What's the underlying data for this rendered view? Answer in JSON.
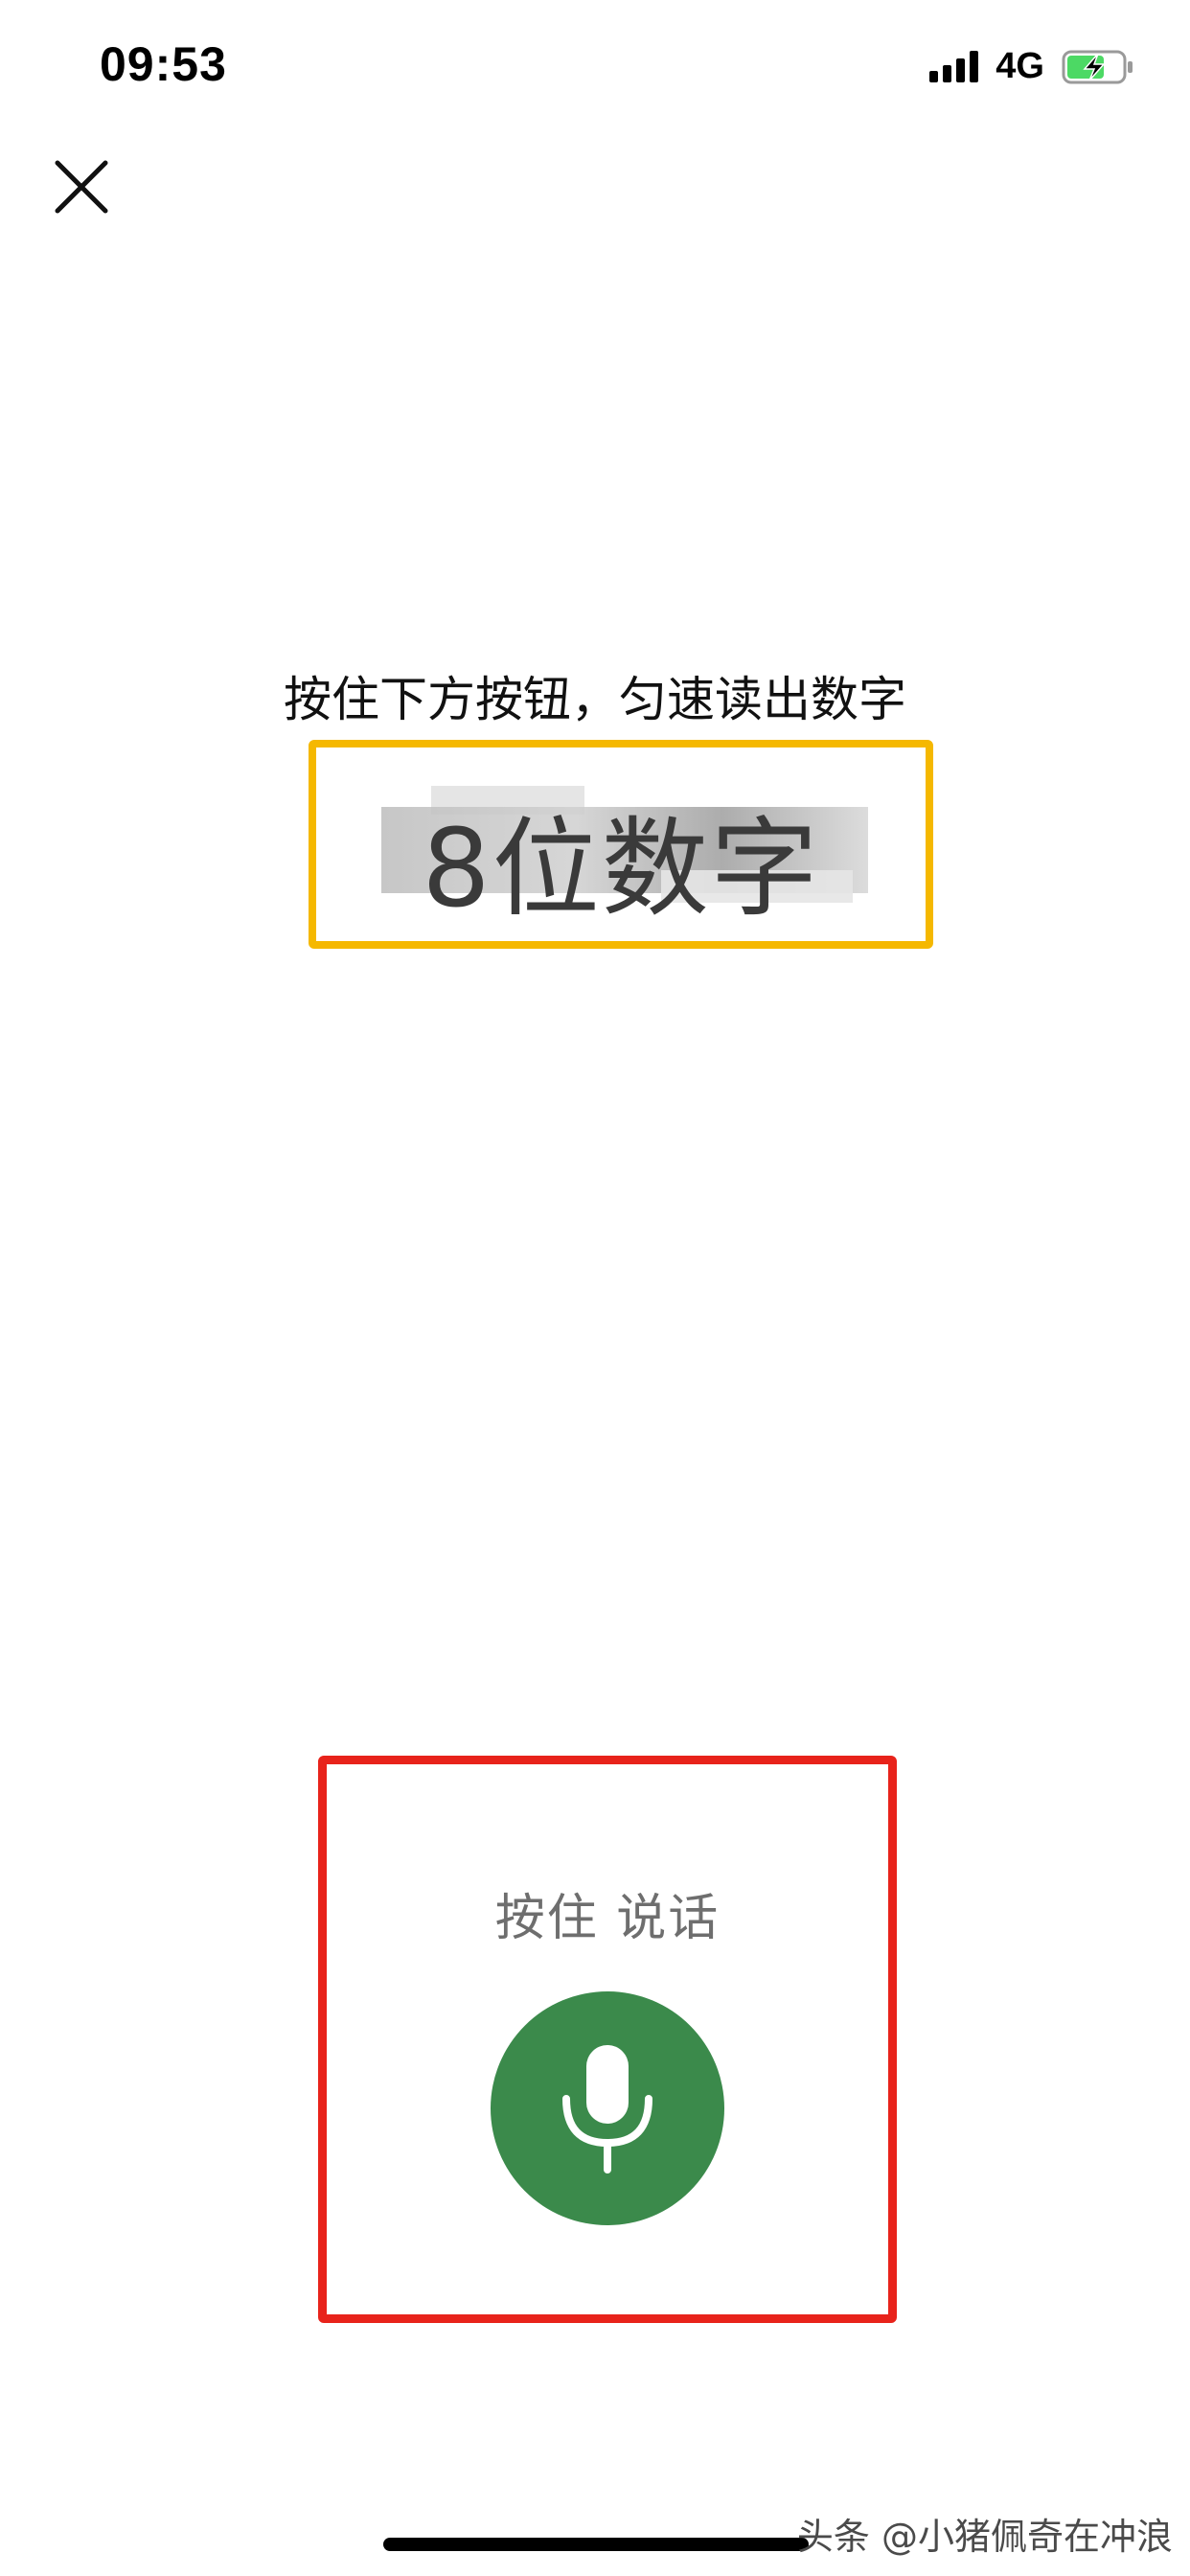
{
  "status_bar": {
    "time": "09:53",
    "network": "4G",
    "icons": [
      "signal-icon",
      "battery-charging-icon"
    ]
  },
  "header": {
    "close_icon": "close-icon"
  },
  "main": {
    "instruction": "按住下方按钮，匀速读出数字",
    "digits_placeholder": "8位数字"
  },
  "speak": {
    "label": "按住 说话",
    "mic_icon": "microphone-icon",
    "button_color": "#3b8a4b"
  },
  "highlight_colors": {
    "digits_box": "#f5b800",
    "speak_box": "#e8231b"
  },
  "watermark": {
    "text": "头条 @小猪佩奇在冲浪"
  }
}
